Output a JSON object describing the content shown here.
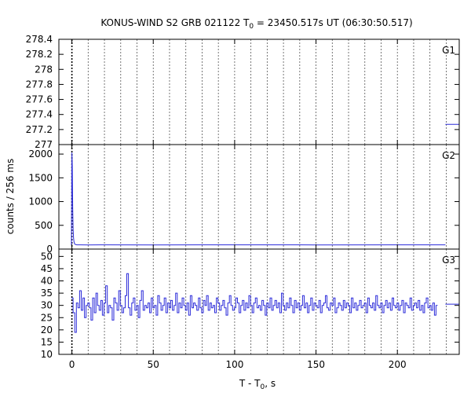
{
  "figure": {
    "title_main": "KONUS-WIND S2 GRB 021122 T",
    "title_sub": "0",
    "title_rest": " = 23450.517s UT (06:30:50.517)",
    "ylabel": "counts / 256 ms",
    "xlabel_main": "T - T",
    "xlabel_sub": "0",
    "xlabel_rest": ", s"
  },
  "colors": {
    "data": "#2b2bd9",
    "axis": "#000000",
    "grid": "#555555"
  },
  "chart_data": [
    {
      "type": "line",
      "panel": "G1",
      "title": "KONUS-WIND S2 GRB 021122 T0 = 23450.517s UT (06:30:50.517)",
      "series": [
        {
          "name": "G1",
          "x": [
            229.5,
            238
          ],
          "y": [
            277.27,
            277.27
          ]
        }
      ],
      "ylim": [
        277,
        278.4
      ],
      "yticks": [
        277,
        277.2,
        277.4,
        277.6,
        277.8,
        278,
        278.2,
        278.4
      ],
      "ytick_labels": [
        "277",
        "277.2",
        "277.4",
        "277.6",
        "277.8",
        "278",
        "278.2",
        "278.4"
      ],
      "xlim": [
        -8,
        238
      ],
      "grid": true,
      "t0_marker": 0
    },
    {
      "type": "line",
      "panel": "G2",
      "series": [
        {
          "name": "G2",
          "x": [
            -0.3,
            0.0,
            0.25,
            0.5,
            0.75,
            1.0,
            1.3,
            1.7,
            2.2,
            3,
            5,
            10,
            20,
            50,
            100,
            150,
            200,
            229.5
          ],
          "y": [
            82,
            2030,
            1750,
            880,
            430,
            230,
            150,
            110,
            96,
            90,
            90,
            88,
            89,
            88,
            90,
            88,
            89,
            90
          ]
        }
      ],
      "ylim": [
        0,
        2200
      ],
      "yticks": [
        0,
        500,
        1000,
        1500,
        2000
      ],
      "ytick_labels": [
        "0",
        "500",
        "1000",
        "1500",
        "2000"
      ],
      "xlim": [
        -8,
        238
      ],
      "grid": true,
      "t0_marker": 0
    },
    {
      "type": "line",
      "panel": "G3",
      "series": [
        {
          "name": "G3",
          "x_start": -0.256,
          "x_step": 1.0,
          "y": [
            33,
            27,
            19,
            31,
            29,
            36,
            28,
            33,
            25,
            30,
            31,
            29,
            24,
            33,
            27,
            35,
            30,
            28,
            32,
            26,
            31,
            38,
            27,
            30,
            29,
            24,
            33,
            31,
            28,
            36,
            30,
            27,
            29,
            34,
            43,
            29,
            26,
            31,
            33,
            28,
            30,
            25,
            32,
            36,
            28,
            30,
            29,
            31,
            27,
            33,
            29,
            30,
            26,
            34,
            31,
            28,
            30,
            33,
            27,
            31,
            29,
            32,
            28,
            30,
            35,
            27,
            31,
            29,
            33,
            30,
            28,
            31,
            26,
            34,
            29,
            31,
            30,
            28,
            33,
            29,
            27,
            32,
            30,
            34,
            28,
            31,
            29,
            30,
            27,
            33,
            31,
            28,
            30,
            32,
            29,
            26,
            31,
            34,
            30,
            28,
            29,
            33,
            31,
            27,
            30,
            32,
            28,
            31,
            29,
            34,
            30,
            27,
            31,
            33,
            29,
            30,
            28,
            32,
            30,
            26,
            31,
            29,
            33,
            28,
            30,
            32,
            29,
            31,
            27,
            35,
            30,
            28,
            31,
            29,
            33,
            30,
            27,
            32,
            29,
            31,
            28,
            30,
            34,
            29,
            31,
            27,
            30,
            33,
            28,
            31,
            30,
            29,
            32,
            27,
            30,
            31,
            34,
            29,
            28,
            31,
            30,
            33,
            27,
            29,
            31,
            30,
            28,
            32,
            29,
            31,
            30,
            27,
            33,
            29,
            31,
            28,
            30,
            32,
            29,
            30,
            31,
            27,
            33,
            30,
            29,
            31,
            28,
            34,
            30,
            29,
            31,
            27,
            30,
            32,
            29,
            31,
            28,
            33,
            30,
            29,
            31,
            28,
            30,
            32,
            27,
            31,
            30,
            29,
            33,
            28,
            30,
            31,
            29,
            32,
            28,
            30,
            27,
            31,
            33,
            29,
            30,
            28,
            31,
            26,
            30
          ]
        }
      ],
      "ylim": [
        10,
        53
      ],
      "yticks": [
        10,
        15,
        20,
        25,
        30,
        35,
        40,
        45,
        50
      ],
      "ytick_labels": [
        "10",
        "15",
        "20",
        "25",
        "30",
        "35",
        "40",
        "45",
        "50"
      ],
      "xlim": [
        -8,
        238
      ],
      "xticks": [
        0,
        50,
        100,
        150,
        200
      ],
      "xtick_labels": [
        "0",
        "50",
        "100",
        "150",
        "200"
      ],
      "grid": true,
      "t0_marker": 0,
      "tail": {
        "x": [
          229.5,
          238
        ],
        "y": [
          30.5,
          30.5
        ]
      }
    }
  ]
}
